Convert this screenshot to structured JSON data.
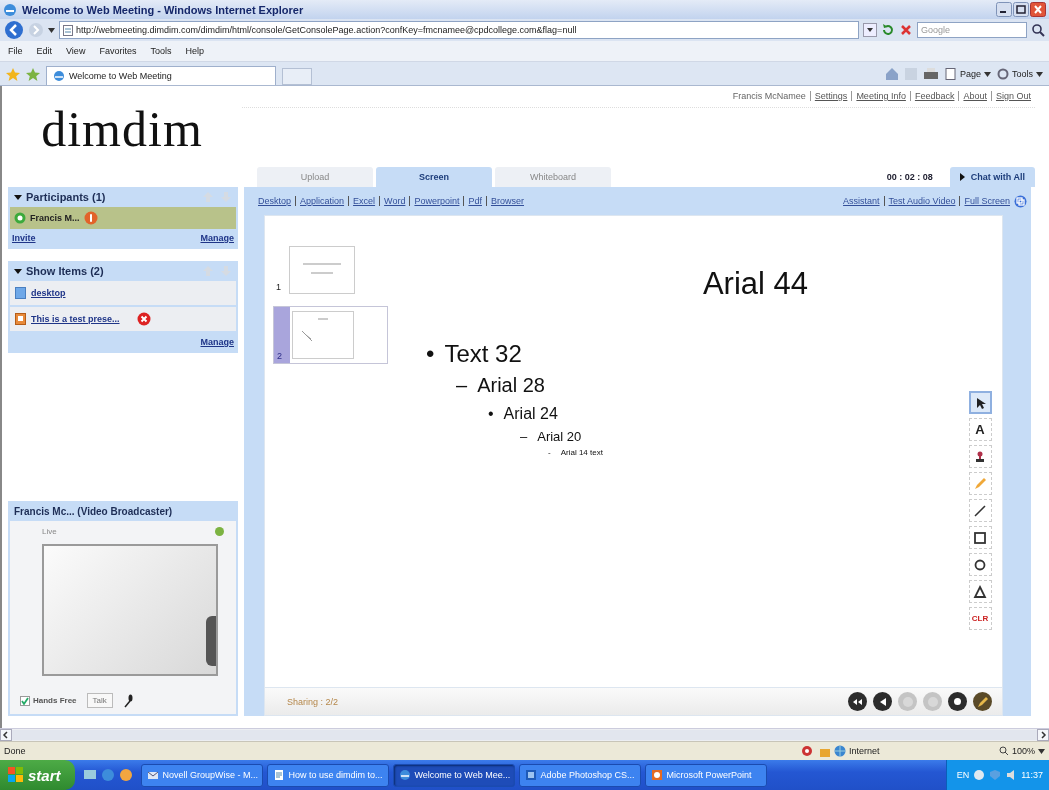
{
  "window": {
    "title": "Welcome to Web Meeting - Windows Internet Explorer"
  },
  "address_bar": {
    "url": "http://webmeeting.dimdim.com/dimdim/html/console/GetConsolePage.action?confKey=fmcnamee@cpdcollege.com&flag=null",
    "search_placeholder": "Google"
  },
  "menu": [
    "File",
    "Edit",
    "View",
    "Favorites",
    "Tools",
    "Help"
  ],
  "browser_tabs": [
    {
      "label": "Welcome to Web Meeting",
      "selected": true
    }
  ],
  "command_bar": [
    "Page",
    "Tools"
  ],
  "page": {
    "logo": "dimdim",
    "top_links": [
      {
        "label": "Francis McNamee",
        "kind": "text"
      },
      {
        "label": "Settings",
        "kind": "link"
      },
      {
        "label": "Meeting Info",
        "kind": "link"
      },
      {
        "label": "Feedback",
        "kind": "link"
      },
      {
        "label": "About",
        "kind": "link"
      },
      {
        "label": "Sign Out",
        "kind": "link"
      }
    ],
    "tabs": [
      {
        "label": "Upload",
        "selected": false
      },
      {
        "label": "Screen",
        "selected": true
      },
      {
        "label": "Whiteboard",
        "selected": false
      }
    ],
    "timer": "00 : 02 : 08",
    "chat_button": "Chat with All",
    "participants": {
      "title": "Participants (1)",
      "expanded": true,
      "items": [
        {
          "name": "Francis M..."
        }
      ],
      "actions": [
        "Invite",
        "Manage"
      ]
    },
    "show_items": {
      "title": "Show Items (2)",
      "expanded": true,
      "items": [
        {
          "kind": "desktop",
          "label": "desktop",
          "removable": false
        },
        {
          "kind": "presentation",
          "label": "This is a test prese...",
          "removable": true
        }
      ],
      "actions": [
        "Manage"
      ]
    },
    "video": {
      "title": "Francis Mc... (Video Broadcaster)",
      "status": "Live",
      "hands_free": {
        "label": "Hands Free",
        "checked": true
      },
      "talk_button": "Talk"
    },
    "share_links": [
      "Desktop",
      "Application",
      "Excel",
      "Word",
      "Powerpoint",
      "Pdf",
      "Browser"
    ],
    "tool_links": [
      "Assistant",
      "Test Audio Video",
      "Full Screen"
    ],
    "slides": [
      {
        "number": "1",
        "selected": false
      },
      {
        "number": "2",
        "selected": true
      }
    ],
    "slide": {
      "title": "Arial 44",
      "bullets": [
        {
          "marker": "•",
          "text": "Text 32",
          "children": [
            {
              "marker": "–",
              "text": "Arial 28",
              "children": [
                {
                  "marker": "•",
                  "text": "Arial 24",
                  "children": [
                    {
                      "marker": "–",
                      "text": "Arial 20",
                      "children": [
                        {
                          "marker": "-",
                          "text": "Arial 14 text"
                        }
                      ]
                    }
                  ]
                }
              ]
            }
          ]
        }
      ]
    },
    "tools": [
      {
        "kind": "pointer",
        "selected": true
      },
      {
        "kind": "text",
        "label": "A",
        "selected": false
      },
      {
        "kind": "stamp",
        "selected": false
      },
      {
        "kind": "pencil",
        "selected": false
      },
      {
        "kind": "line",
        "selected": false
      },
      {
        "kind": "rectangle",
        "selected": false
      },
      {
        "kind": "circle",
        "selected": false
      },
      {
        "kind": "triangle",
        "selected": false
      },
      {
        "kind": "clear",
        "label": "CLR",
        "selected": false
      }
    ],
    "sharing": "Sharing : 2/2",
    "nav_buttons": [
      {
        "kind": "first",
        "disabled": false
      },
      {
        "kind": "previous",
        "disabled": false
      },
      {
        "kind": "next",
        "disabled": true
      },
      {
        "kind": "last",
        "disabled": true
      },
      {
        "kind": "stop",
        "disabled": false
      },
      {
        "kind": "annotate",
        "disabled": false
      }
    ]
  },
  "status_bar": {
    "text": "Done",
    "zone": "Internet",
    "zoom": "100%"
  },
  "taskbar": {
    "start": "start",
    "tasks": [
      {
        "label": "Novell GroupWise - M...",
        "kind": "mail",
        "selected": false
      },
      {
        "label": "How to use dimdim to...",
        "kind": "document",
        "selected": false
      },
      {
        "label": "Welcome to Web Mee...",
        "kind": "browser",
        "selected": true
      },
      {
        "label": "Adobe Photoshop CS...",
        "kind": "photoshop",
        "selected": false
      },
      {
        "label": "Microsoft PowerPoint",
        "kind": "powerpoint",
        "selected": false
      }
    ],
    "language": "EN",
    "clock": "11:37"
  }
}
